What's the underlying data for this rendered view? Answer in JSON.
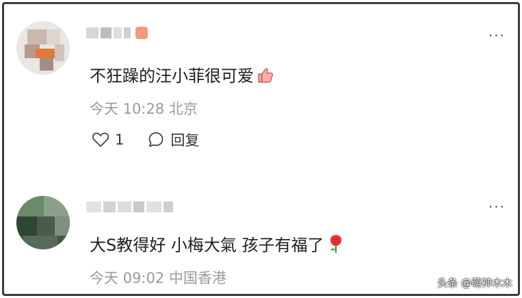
{
  "comments": [
    {
      "text": "不狂躁的汪小菲很可爱",
      "time": "今天 10:28",
      "location": "北京",
      "like_count": "1",
      "reply_label": "回复"
    },
    {
      "text": "大S教得好 小梅大氣 孩子有福了",
      "time": "今天 09:02",
      "location": "中国香港"
    }
  ],
  "more_label": "···",
  "watermark": "头条 @萌神木木",
  "icons": {
    "comment1_emoji": "thumbs-up-icon",
    "comment2_emoji": "rose-icon",
    "like": "heart-outline-icon",
    "reply": "speech-bubble-icon",
    "more": "ellipsis-icon"
  },
  "colors": {
    "frame_border": "#3a3a3a",
    "text": "#1e1e1e",
    "meta": "#9a9a9a"
  }
}
